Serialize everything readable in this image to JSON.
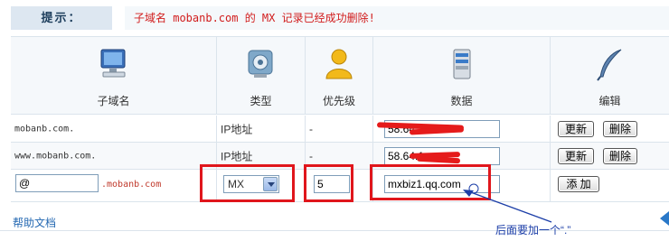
{
  "notice": {
    "label": "提示：",
    "message": "子域名 mobanb.com 的 MX 记录已经成功删除!"
  },
  "columns": [
    {
      "label": "子域名",
      "icon": "computer-icon"
    },
    {
      "label": "类型",
      "icon": "settings-gear-icon"
    },
    {
      "label": "优先级",
      "icon": "user-icon"
    },
    {
      "label": "数据",
      "icon": "server-icon"
    },
    {
      "label": "编辑",
      "icon": "quill-pen-icon"
    }
  ],
  "records": [
    {
      "subdomain": "mobanb.com.",
      "type": "IP地址",
      "priority": "-",
      "data": "58.64.1",
      "edit_label": "更新",
      "delete_label": "删除"
    },
    {
      "subdomain": "www.mobanb.com.",
      "type": "IP地址",
      "priority": "-",
      "data": "58.64.1",
      "edit_label": "更新",
      "delete_label": "删除"
    }
  ],
  "new_record": {
    "subdomain_value": "@",
    "domain_suffix": ".mobanb.com",
    "type_value": "MX",
    "priority_value": "5",
    "data_value": "mxbiz1.qq.com",
    "add_label": "添 加"
  },
  "footer": {
    "help_link": "帮助文档",
    "annotation": "后面要加一个“.”"
  },
  "colors": {
    "accent": "#2468b2",
    "highlight": "#e0161c",
    "annotation": "#1d3fa8"
  }
}
